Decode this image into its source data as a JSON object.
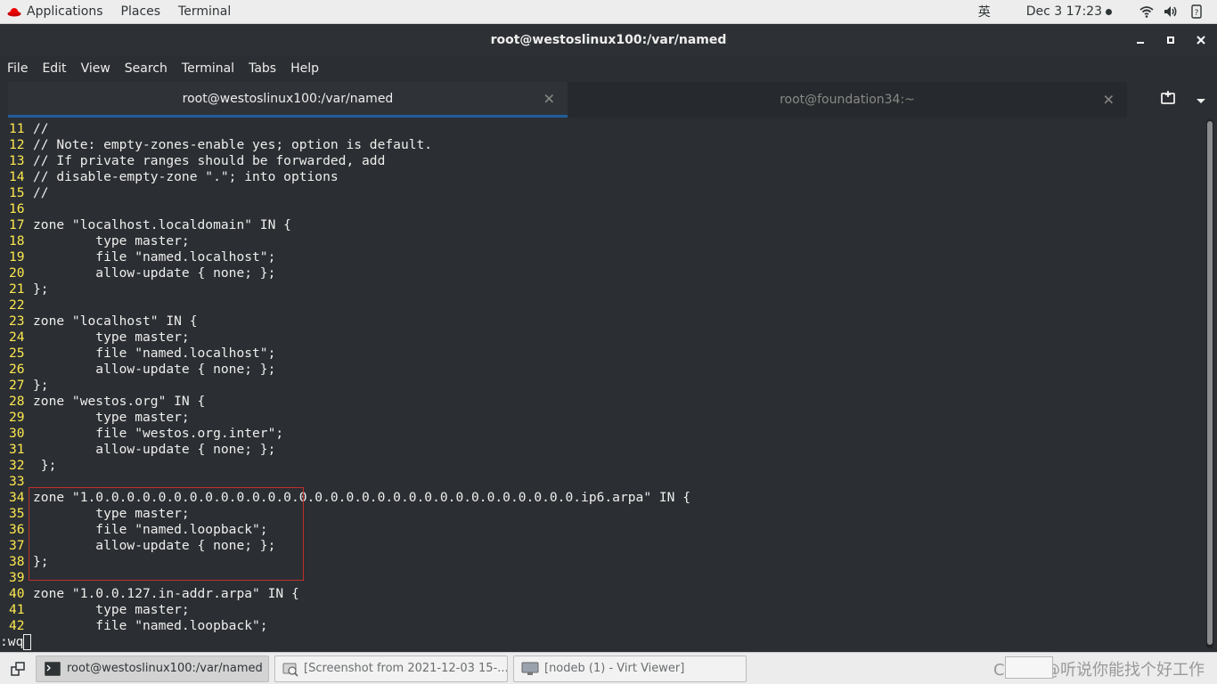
{
  "topbar": {
    "applications": "Applications",
    "places": "Places",
    "terminal": "Terminal",
    "input_method": "英",
    "clock": "Dec 3  17:23"
  },
  "window": {
    "title": "root@westoslinux100:/var/named"
  },
  "menubar": {
    "items": [
      "File",
      "Edit",
      "View",
      "Search",
      "Terminal",
      "Tabs",
      "Help"
    ]
  },
  "tabs": [
    {
      "label": "root@westoslinux100:/var/named",
      "active": true
    },
    {
      "label": "root@foundation34:~",
      "active": false
    }
  ],
  "editor": {
    "lines": [
      {
        "n": "11",
        "text": "//"
      },
      {
        "n": "12",
        "text": "// Note: empty-zones-enable yes; option is default."
      },
      {
        "n": "13",
        "text": "// If private ranges should be forwarded, add"
      },
      {
        "n": "14",
        "text": "// disable-empty-zone \".\"; into options"
      },
      {
        "n": "15",
        "text": "//"
      },
      {
        "n": "16",
        "text": ""
      },
      {
        "n": "17",
        "text": "zone \"localhost.localdomain\" IN {"
      },
      {
        "n": "18",
        "text": "        type master;"
      },
      {
        "n": "19",
        "text": "        file \"named.localhost\";"
      },
      {
        "n": "20",
        "text": "        allow-update { none; };"
      },
      {
        "n": "21",
        "text": "};"
      },
      {
        "n": "22",
        "text": ""
      },
      {
        "n": "23",
        "text": "zone \"localhost\" IN {"
      },
      {
        "n": "24",
        "text": "        type master;"
      },
      {
        "n": "25",
        "text": "        file \"named.localhost\";"
      },
      {
        "n": "26",
        "text": "        allow-update { none; };"
      },
      {
        "n": "27",
        "text": "};"
      },
      {
        "n": "28",
        "text": "zone \"westos.org\" IN {"
      },
      {
        "n": "29",
        "text": "        type master;"
      },
      {
        "n": "30",
        "text": "        file \"westos.org.inter\";"
      },
      {
        "n": "31",
        "text": "        allow-update { none; };"
      },
      {
        "n": "32",
        "text": " };"
      },
      {
        "n": "33",
        "text": ""
      },
      {
        "n": "34",
        "text": "zone \"1.0.0.0.0.0.0.0.0.0.0.0.0.0.0.0.0.0.0.0.0.0.0.0.0.0.0.0.0.0.0.0.ip6.arpa\" IN {"
      },
      {
        "n": "35",
        "text": "        type master;"
      },
      {
        "n": "36",
        "text": "        file \"named.loopback\";"
      },
      {
        "n": "37",
        "text": "        allow-update { none; };"
      },
      {
        "n": "38",
        "text": "};"
      },
      {
        "n": "39",
        "text": ""
      },
      {
        "n": "40",
        "text": "zone \"1.0.0.127.in-addr.arpa\" IN {"
      },
      {
        "n": "41",
        "text": "        type master;"
      },
      {
        "n": "42",
        "text": "        file \"named.loopback\";"
      }
    ],
    "command": ":wq",
    "highlight_color": "#c2302a"
  },
  "taskbar": {
    "items": [
      {
        "label": "root@westoslinux100:/var/named",
        "icon": "terminal-icon",
        "active": true
      },
      {
        "label": "[Screenshot from 2021-12-03 15-...",
        "icon": "screenshot-icon",
        "active": false
      },
      {
        "label": "[nodeb (1) - Virt Viewer]",
        "icon": "virt-viewer-icon",
        "active": false
      }
    ],
    "watermark": "CSDN @听说你能找个好工作"
  },
  "colors": {
    "terminal_bg": "#2b2e33",
    "line_number": "#fce94f",
    "tab_accent": "#215d9c"
  }
}
